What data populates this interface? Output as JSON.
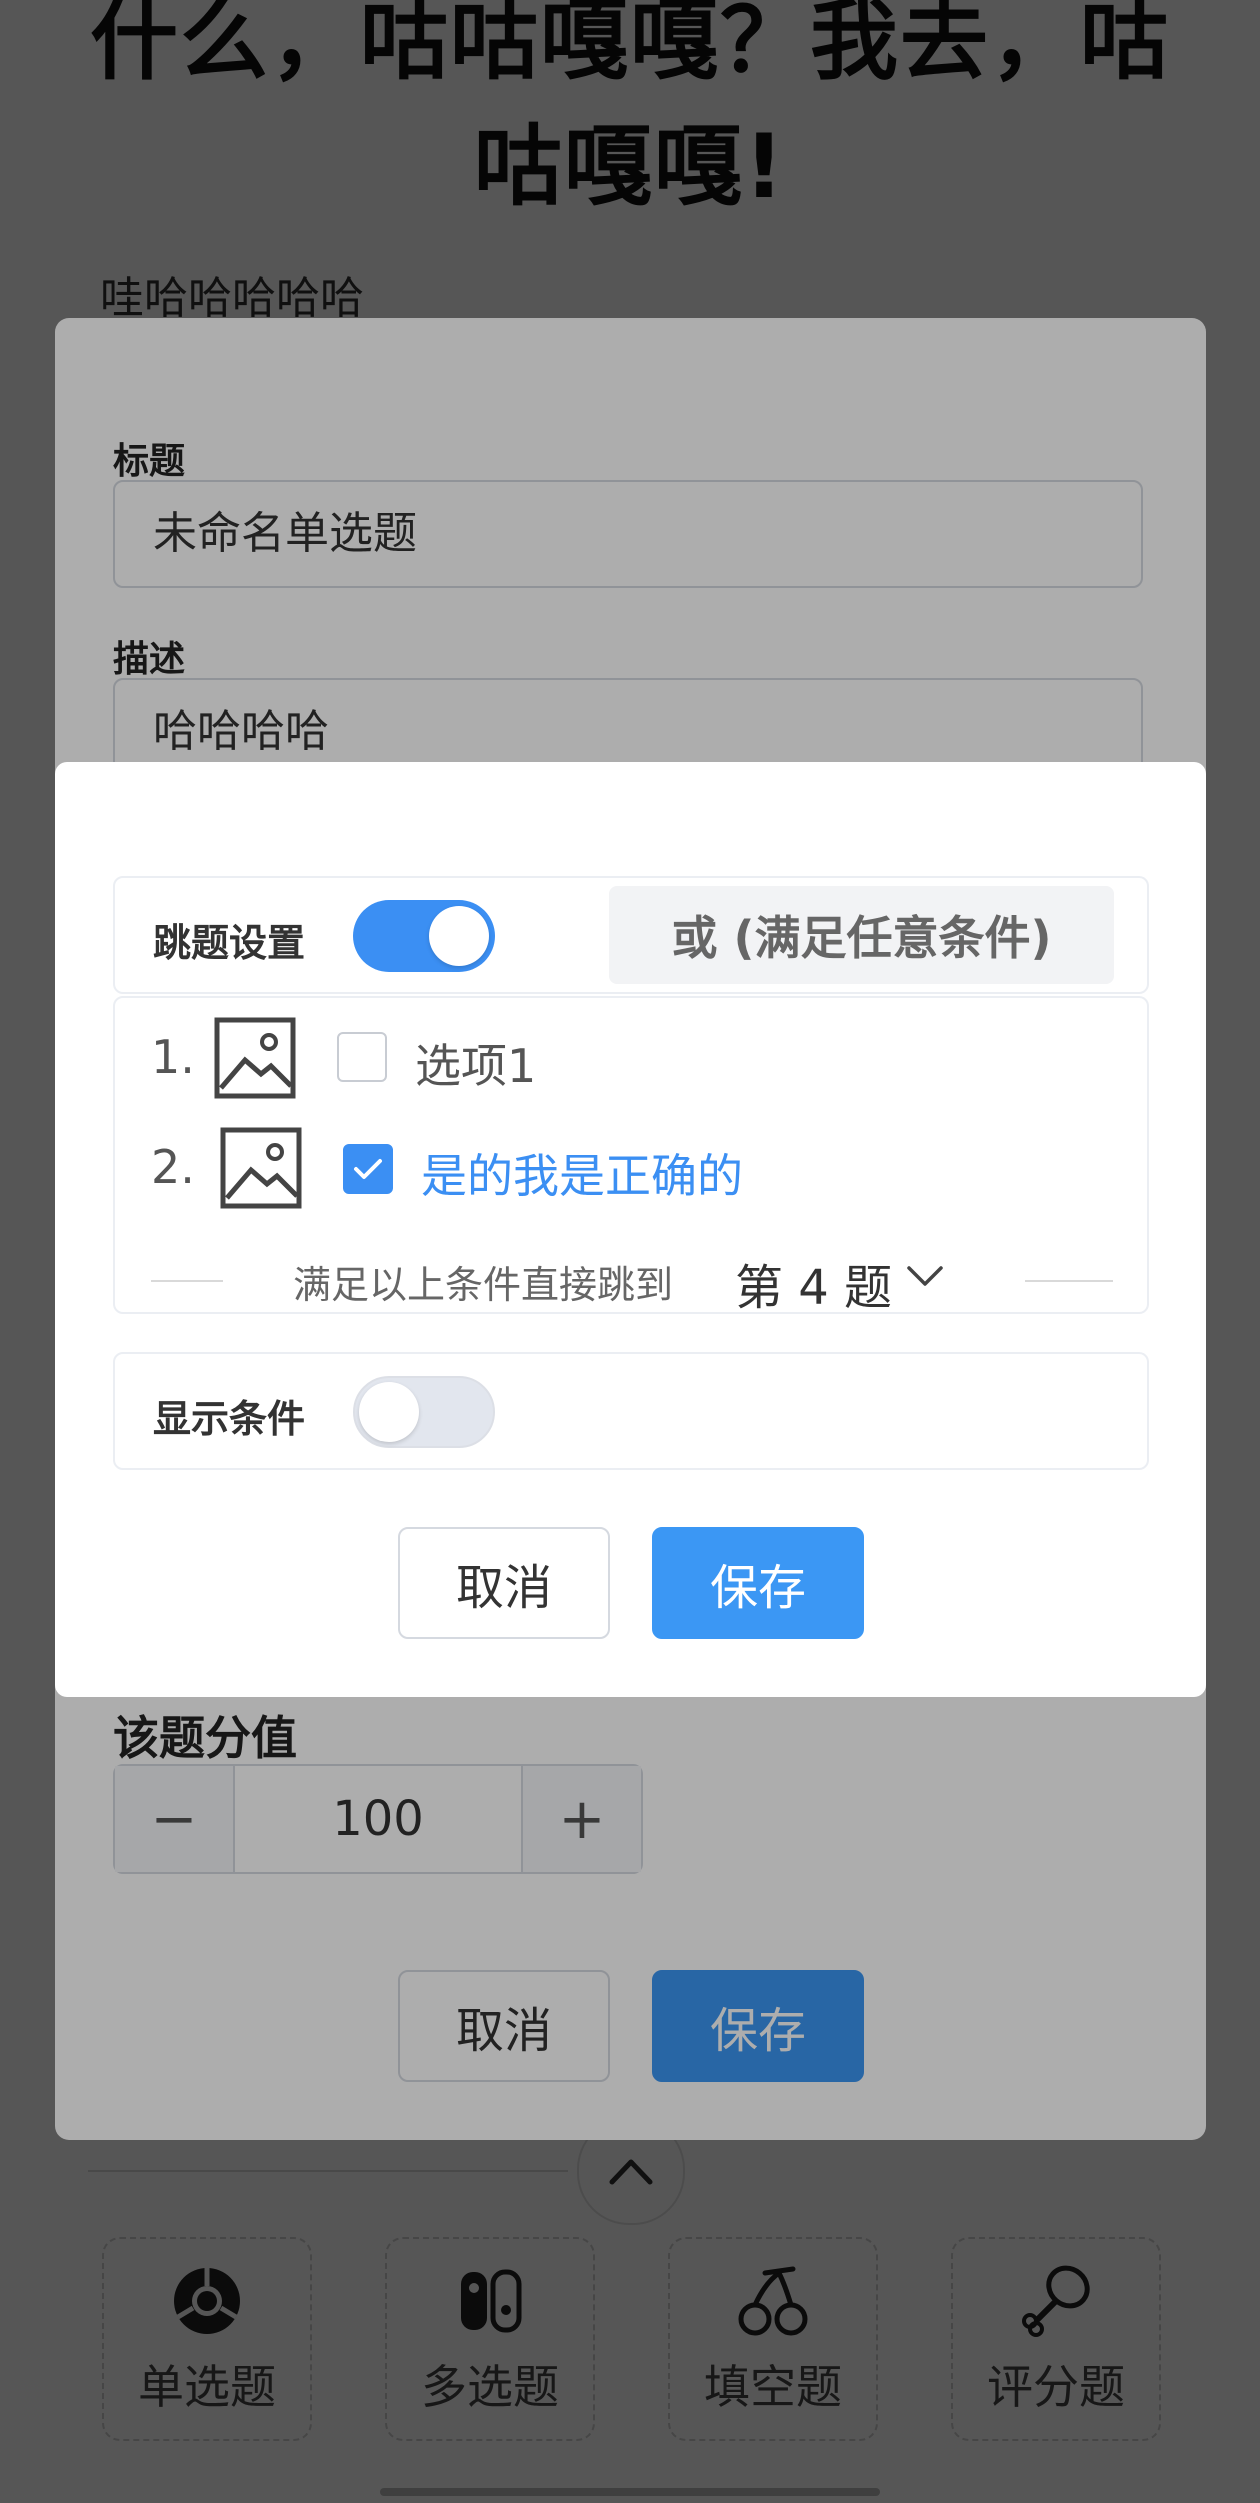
{
  "page": {
    "heading": "什么，咕咕嘎嘎？我去，咕咕嘎嘎!",
    "subtitle": "哇哈哈哈哈哈"
  },
  "edit_panel": {
    "title_label": "标题",
    "title_value": "未命名单选题",
    "description_label": "描述",
    "description_value": "哈哈哈哈",
    "score_label": "该题分值",
    "score_value": "100",
    "decrement": "−",
    "increment": "+",
    "cancel_label": "取消",
    "save_label": "保存"
  },
  "dialog": {
    "jump_label": "跳题设置",
    "jump_enabled": true,
    "mode_label": "或 (满足任意条件)",
    "options": [
      {
        "num": "1.",
        "label": "选项1",
        "checked": false
      },
      {
        "num": "2.",
        "label": "是的我是正确的",
        "checked": true
      }
    ],
    "jump_text": "满足以上条件直接跳到",
    "jump_target": "第 4 题",
    "display_label": "显示条件",
    "display_enabled": false,
    "cancel_label": "取消",
    "save_label": "保存"
  },
  "toolbar": {
    "items": [
      {
        "label": "单选题",
        "icon": "chrome-icon"
      },
      {
        "label": "多选题",
        "icon": "switch-console-icon"
      },
      {
        "label": "填空题",
        "icon": "cherry-icon"
      },
      {
        "label": "评分题",
        "icon": "drumstick-icon"
      }
    ]
  },
  "colors": {
    "accent": "#3b8ff3",
    "save_button": "#3b97f4",
    "selected_option_text": "#3b8ff3"
  }
}
